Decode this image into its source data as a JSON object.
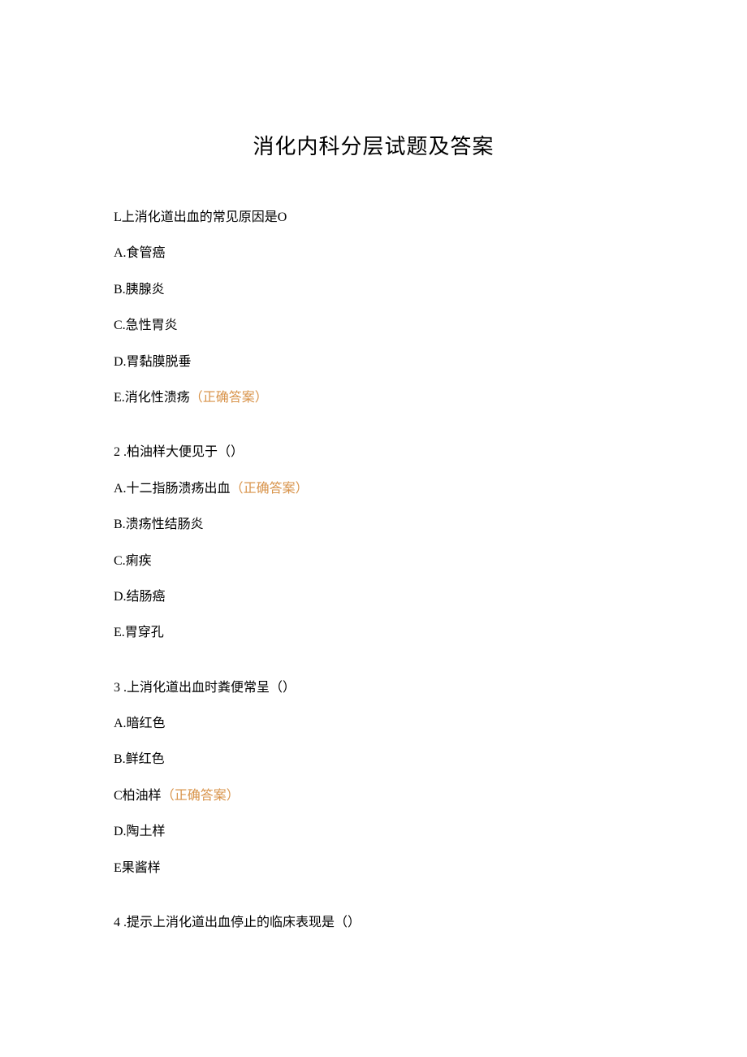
{
  "title": "消化内科分层试题及答案",
  "correct_label": "（正确答案）",
  "questions": [
    {
      "text": "L上消化道出血的常见原因是O",
      "options": [
        {
          "label": "A.食管癌",
          "correct": false
        },
        {
          "label": "B.胰腺炎",
          "correct": false
        },
        {
          "label": "C.急性胃炎",
          "correct": false
        },
        {
          "label": "D.胃黏膜脱垂",
          "correct": false
        },
        {
          "label": "E.消化性溃疡",
          "correct": true
        }
      ]
    },
    {
      "num": "2",
      "text": ".柏油样大便见于（）",
      "options": [
        {
          "label": "A.十二指肠溃疡出血",
          "correct": true
        },
        {
          "label": "B.溃疡性结肠炎",
          "correct": false
        },
        {
          "label": "C.痢疾",
          "correct": false
        },
        {
          "label": "D.结肠癌",
          "correct": false
        },
        {
          "label": "E.胃穿孔",
          "correct": false
        }
      ]
    },
    {
      "num": "3",
      "text": ".上消化道出血时粪便常呈（）",
      "options": [
        {
          "label": "A.暗红色",
          "correct": false
        },
        {
          "label": "B.鲜红色",
          "correct": false
        },
        {
          "label": "C柏油样",
          "correct": true
        },
        {
          "label": "D.陶土样",
          "correct": false
        },
        {
          "label": "E果酱样",
          "correct": false
        }
      ]
    },
    {
      "num": "4",
      "text": ".提示上消化道出血停止的临床表现是（）",
      "options": []
    }
  ]
}
